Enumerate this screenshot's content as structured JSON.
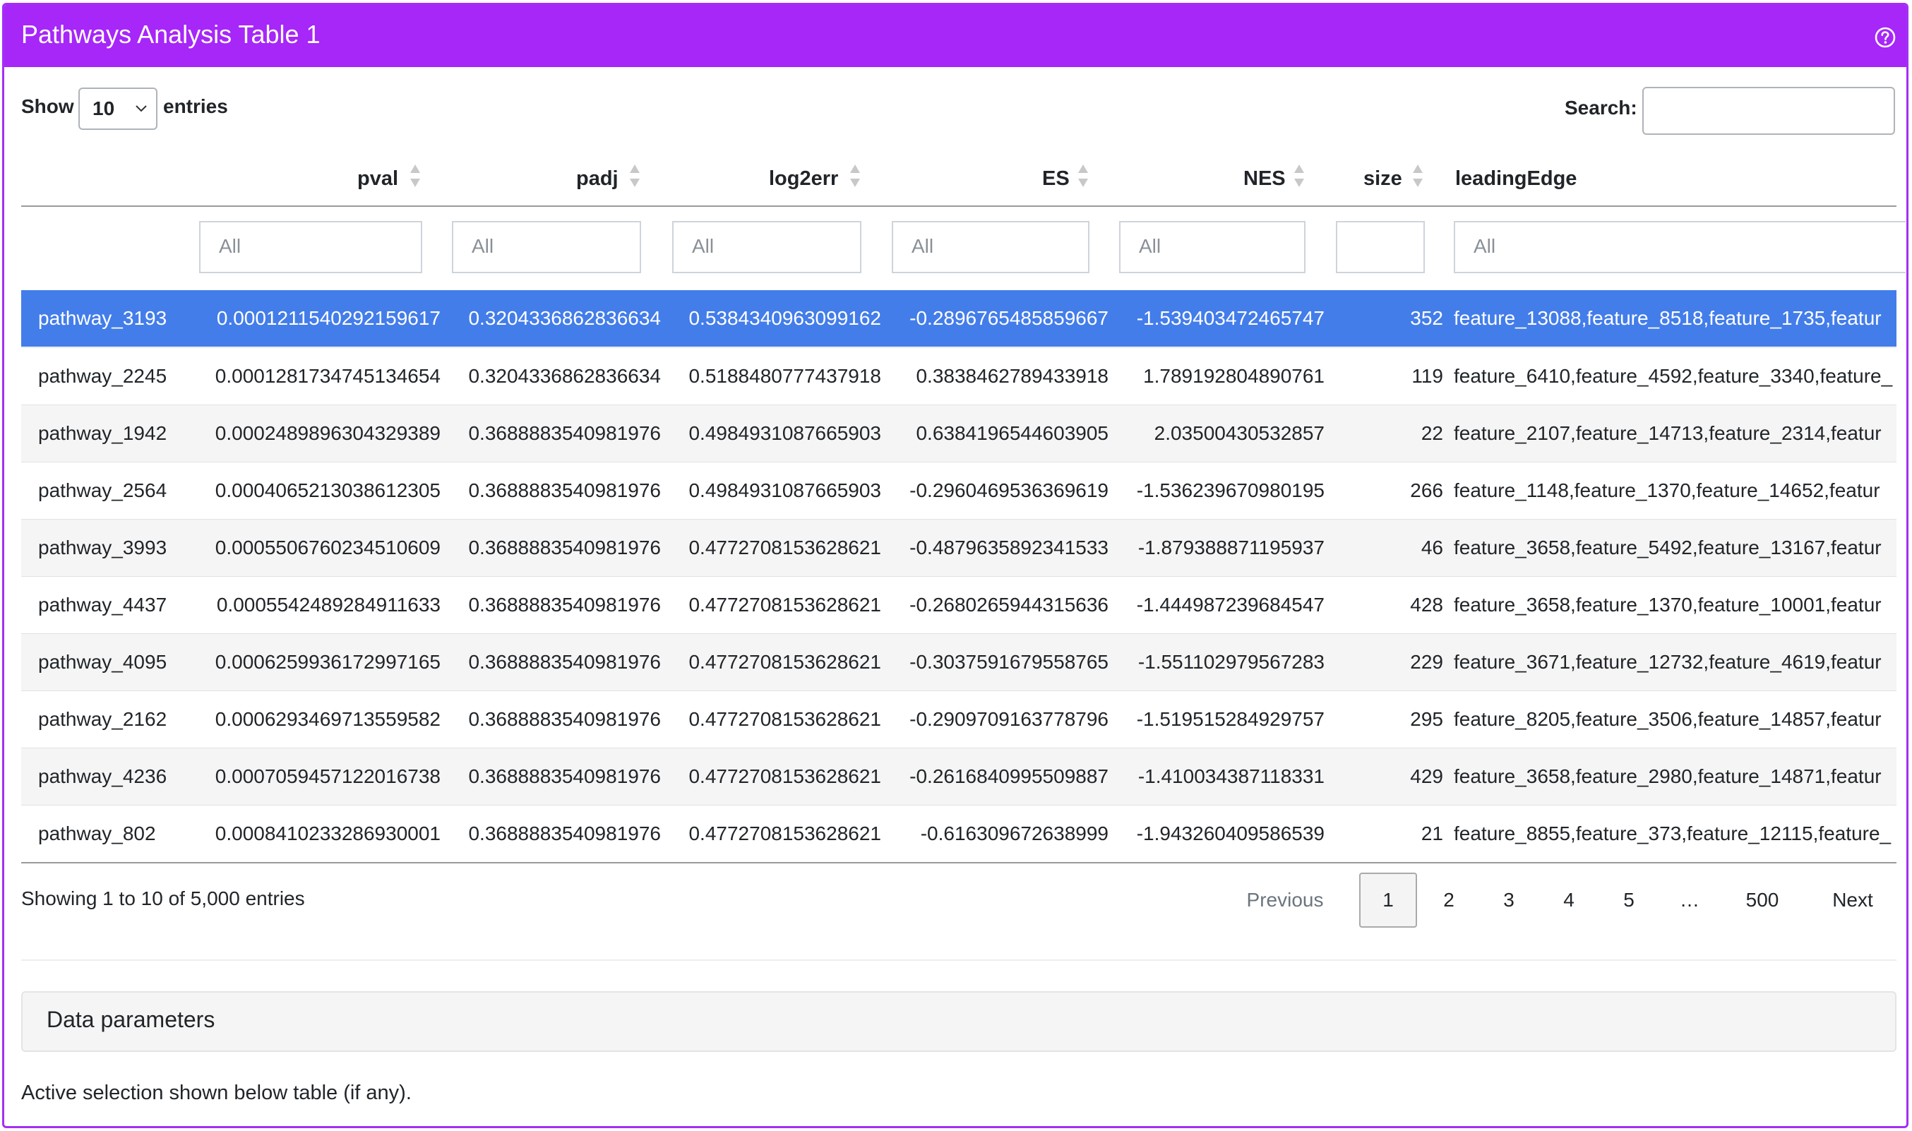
{
  "panel": {
    "title": "Pathways Analysis Table 1",
    "help_icon": "question-circle-icon",
    "accent_color": "#a726f8"
  },
  "controls": {
    "show_label": "Show",
    "page_length": "10",
    "entries_label": "entries",
    "search_label": "Search:",
    "search_value": ""
  },
  "table": {
    "columns": [
      {
        "label": "",
        "sortable": false
      },
      {
        "label": "pval",
        "sortable": true
      },
      {
        "label": "padj",
        "sortable": true
      },
      {
        "label": "log2err",
        "sortable": true
      },
      {
        "label": "ES",
        "sortable": true
      },
      {
        "label": "NES",
        "sortable": true
      },
      {
        "label": "size",
        "sortable": true
      },
      {
        "label": "leadingEdge",
        "sortable": false
      }
    ],
    "filters": [
      "All",
      "All",
      "All",
      "All",
      "All",
      "",
      "All"
    ],
    "selected_row_color": "#437dea",
    "rows": [
      [
        "pathway_3193",
        "0.0001211540292159617",
        "0.3204336862836634",
        "0.5384340963099162",
        "-0.2896765485859667",
        "-1.539403472465747",
        "352",
        "feature_13088,feature_8518,feature_1735,featur"
      ],
      [
        "pathway_2245",
        "0.0001281734745134654",
        "0.3204336862836634",
        "0.5188480777437918",
        "0.3838462789433918",
        "1.789192804890761",
        "119",
        "feature_6410,feature_4592,feature_3340,feature_"
      ],
      [
        "pathway_1942",
        "0.0002489896304329389",
        "0.3688883540981976",
        "0.4984931087665903",
        "0.6384196544603905",
        "2.03500430532857",
        "22",
        "feature_2107,feature_14713,feature_2314,featur"
      ],
      [
        "pathway_2564",
        "0.0004065213038612305",
        "0.3688883540981976",
        "0.4984931087665903",
        "-0.2960469536369619",
        "-1.536239670980195",
        "266",
        "feature_1148,feature_1370,feature_14652,featur"
      ],
      [
        "pathway_3993",
        "0.0005506760234510609",
        "0.3688883540981976",
        "0.4772708153628621",
        "-0.4879635892341533",
        "-1.879388871195937",
        "46",
        "feature_3658,feature_5492,feature_13167,featur"
      ],
      [
        "pathway_4437",
        "0.0005542489284911633",
        "0.3688883540981976",
        "0.4772708153628621",
        "-0.2680265944315636",
        "-1.444987239684547",
        "428",
        "feature_3658,feature_1370,feature_10001,featur"
      ],
      [
        "pathway_4095",
        "0.0006259936172997165",
        "0.3688883540981976",
        "0.4772708153628621",
        "-0.3037591679558765",
        "-1.551102979567283",
        "229",
        "feature_3671,feature_12732,feature_4619,featur"
      ],
      [
        "pathway_2162",
        "0.0006293469713559582",
        "0.3688883540981976",
        "0.4772708153628621",
        "-0.2909709163778796",
        "-1.519515284929757",
        "295",
        "feature_8205,feature_3506,feature_14857,featur"
      ],
      [
        "pathway_4236",
        "0.0007059457122016738",
        "0.3688883540981976",
        "0.4772708153628621",
        "-0.2616840995509887",
        "-1.410034387118331",
        "429",
        "feature_3658,feature_2980,feature_14871,featur"
      ],
      [
        "pathway_802",
        "0.0008410233286930001",
        "0.3688883540981976",
        "0.4772708153628621",
        "-0.616309672638999",
        "-1.943260409586539",
        "21",
        "feature_8855,feature_373,feature_12115,feature_"
      ]
    ]
  },
  "info": "Showing 1 to 10 of 5,000 entries",
  "pagination": {
    "previous": "Previous",
    "pages": [
      "1",
      "2",
      "3",
      "4",
      "5",
      "…",
      "500"
    ],
    "current": "1",
    "next": "Next"
  },
  "accordion": {
    "title": "Data parameters"
  },
  "note": "Active selection shown below table (if any)."
}
